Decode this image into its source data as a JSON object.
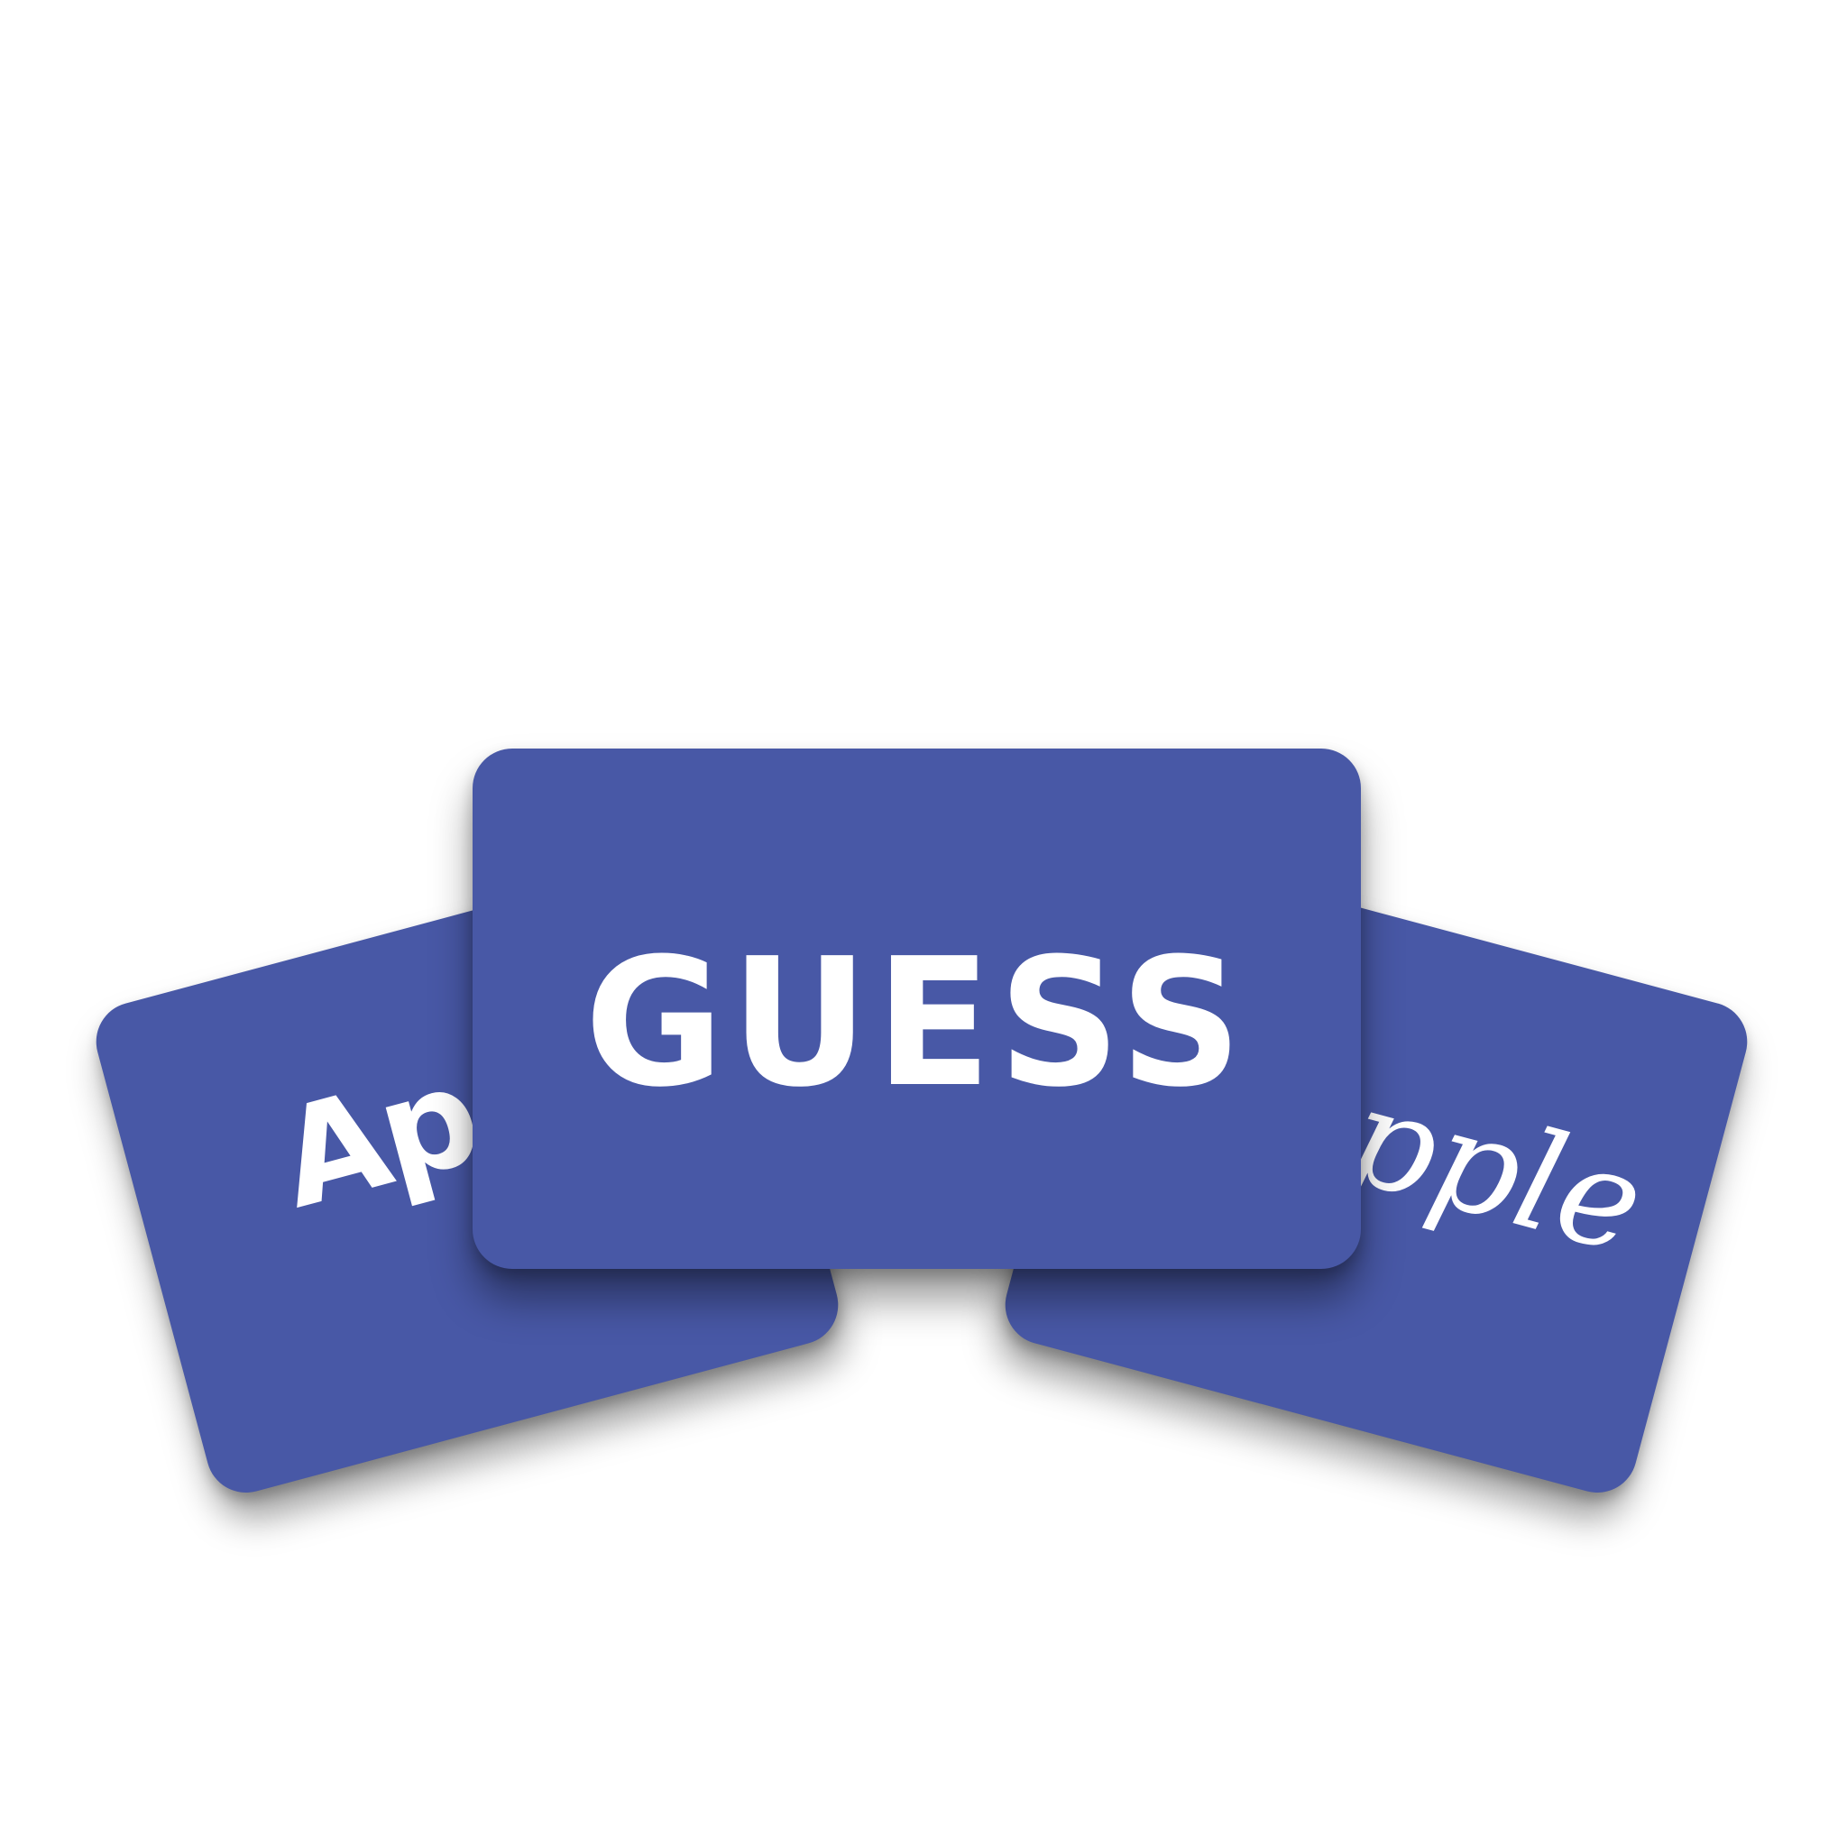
{
  "game": {
    "cards": {
      "left": {
        "word": "Apple"
      },
      "right": {
        "word": "Apple"
      },
      "center": {
        "word": "GUESS"
      }
    }
  },
  "colors": {
    "background": "#ffffff",
    "card": "#4858a6",
    "text": "#ffffff"
  }
}
